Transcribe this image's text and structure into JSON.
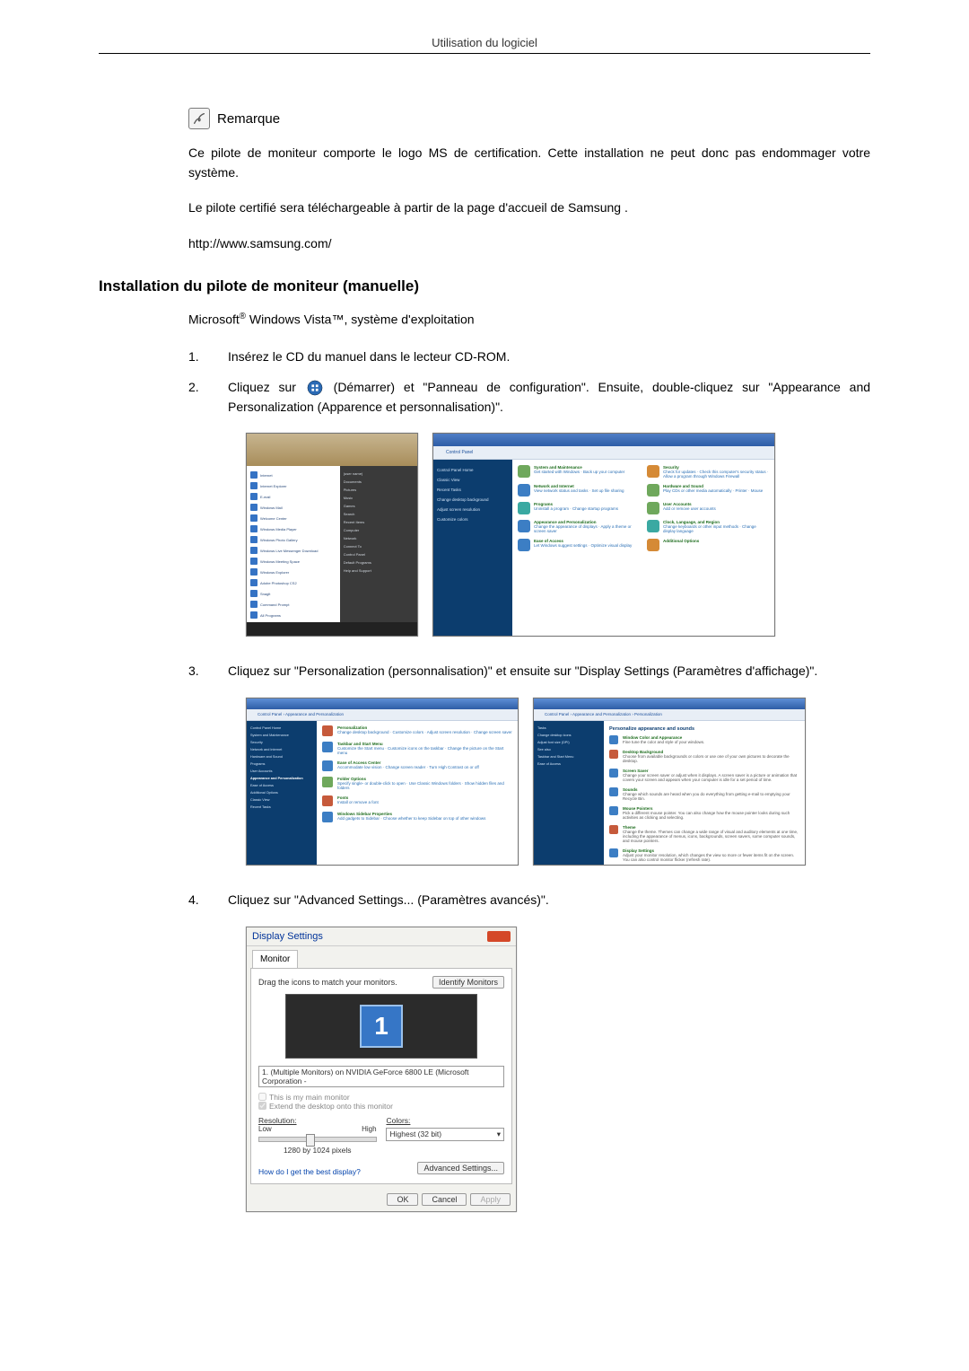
{
  "header": {
    "title": "Utilisation du logiciel"
  },
  "note": {
    "label": "Remarque",
    "p1": "Ce pilote de moniteur comporte le logo MS de certification. Cette installation ne peut donc pas endommager votre système.",
    "p2": "Le pilote certifié sera téléchargeable à partir de la page d'accueil de Samsung .",
    "url": "http://www.samsung.com/"
  },
  "heading": "Installation du pilote de moniteur (manuelle)",
  "os_line_prefix": "Microsoft",
  "os_line_mid": " Windows Vista™",
  "os_line_suffix": ", système d'exploitation",
  "steps": [
    {
      "n": "1.",
      "t": "Insérez le CD du manuel dans le lecteur CD-ROM."
    },
    {
      "n": "2.",
      "t_a": "Cliquez sur",
      "t_b": "(Démarrer) et \"Panneau de configuration\". Ensuite, double-cliquez sur \"Appearance and Personalization (Apparence et personnalisation)\"."
    },
    {
      "n": "3.",
      "t": "Cliquez sur \"Personalization (personnalisation)\" et ensuite sur \"Display Settings (Paramètres d'affichage)\"."
    },
    {
      "n": "4.",
      "t": "Cliquez sur \"Advanced Settings... (Paramètres avancés)\"."
    }
  ],
  "start_menu": {
    "left": [
      "Internet",
      "Internet Explorer",
      "E-mail",
      "Windows Mail",
      "Welcome Center",
      "Windows Media Player",
      "Windows Photo Gallery",
      "Windows Live Messenger Download",
      "Windows Meeting Space",
      "Windows Explorer",
      "Adobe Photoshop CS2",
      "Snaglt",
      "Command Prompt",
      "All Programs"
    ],
    "right": [
      "(user name)",
      "Documents",
      "Pictures",
      "Music",
      "Games",
      "Search",
      "Recent Items",
      "Computer",
      "Network",
      "Connect To",
      "Control Panel",
      "Default Programs",
      "Help and Support"
    ]
  },
  "control_panel": {
    "addr": "Control Panel",
    "side": [
      "Control Panel Home",
      "Classic View",
      "Recent Tasks",
      "Change desktop background",
      "Adjust screen resolution",
      "Customize colors"
    ],
    "cats": [
      {
        "t": "System and Maintenance",
        "s": "Get started with Windows · Back up your computer"
      },
      {
        "t": "Security",
        "s": "Check for updates · Check this computer's security status · Allow a program through Windows Firewall"
      },
      {
        "t": "Network and Internet",
        "s": "View network status and tasks · Set up file sharing"
      },
      {
        "t": "Hardware and Sound",
        "s": "Play CDs or other media automatically · Printer · Mouse"
      },
      {
        "t": "Programs",
        "s": "Uninstall a program · Change startup programs"
      },
      {
        "t": "User Accounts",
        "s": "Add or remove user accounts"
      },
      {
        "t": "Appearance and Personalization",
        "s": "Change the appearance of displays · Apply a theme or screen saver"
      },
      {
        "t": "Clock, Language, and Region",
        "s": "Change keyboards or other input methods · Change display language"
      },
      {
        "t": "Ease of Access",
        "s": "Let Windows suggest settings · Optimize visual display"
      },
      {
        "t": "Additional Options",
        "s": ""
      }
    ]
  },
  "ap_panel": {
    "addr": "Control Panel › Appearance and Personalization",
    "side": [
      "Control Panel Home",
      "System and Maintenance",
      "Security",
      "Network and Internet",
      "Hardware and Sound",
      "Programs",
      "User Accounts",
      "Appearance and Personalization",
      "Ease of Access",
      "Additional Options",
      "Classic View",
      "Recent Tasks"
    ],
    "grps": [
      {
        "h": "Personalization",
        "l": "Change desktop background · Customize colors · Adjust screen resolution · Change screen saver"
      },
      {
        "h": "Taskbar and Start Menu",
        "l": "Customize the Start menu · Customize icons on the taskbar · Change the picture on the Start menu"
      },
      {
        "h": "Ease of Access Center",
        "l": "Accommodate low vision · Change screen reader · Turn High Contrast on or off"
      },
      {
        "h": "Folder Options",
        "l": "Specify single- or double-click to open · Use Classic Windows folders · Show hidden files and folders"
      },
      {
        "h": "Fonts",
        "l": "Install or remove a font"
      },
      {
        "h": "Windows Sidebar Properties",
        "l": "Add gadgets to Sidebar · Choose whether to keep Sidebar on top of other windows"
      }
    ]
  },
  "pers_panel": {
    "addr": "Control Panel › Appearance and Personalization › Personalization",
    "side": [
      "Tasks",
      "Change desktop icons",
      "Adjust font size (DPI)",
      "See also",
      "Taskbar and Start Menu",
      "Ease of Access"
    ],
    "hdr": "Personalize appearance and sounds",
    "rows": [
      {
        "h": "Window Color and Appearance",
        "d": "Fine tune the color and style of your windows."
      },
      {
        "h": "Desktop Background",
        "d": "Choose from available backgrounds or colors or use one of your own pictures to decorate the desktop."
      },
      {
        "h": "Screen Saver",
        "d": "Change your screen saver or adjust when it displays. A screen saver is a picture or animation that covers your screen and appears when your computer is idle for a set period of time."
      },
      {
        "h": "Sounds",
        "d": "Change which sounds are heard when you do everything from getting e-mail to emptying your Recycle Bin."
      },
      {
        "h": "Mouse Pointers",
        "d": "Pick a different mouse pointer. You can also change how the mouse pointer looks during such activities as clicking and selecting."
      },
      {
        "h": "Theme",
        "d": "Change the theme. Themes can change a wide range of visual and auditory elements at one time, including the appearance of menus, icons, backgrounds, screen savers, some computer sounds, and mouse pointers."
      },
      {
        "h": "Display Settings",
        "d": "Adjust your monitor resolution, which changes the view so more or fewer items fit on the screen. You can also control monitor flicker (refresh rate)."
      }
    ]
  },
  "disp": {
    "title": "Display Settings",
    "tab": "Monitor",
    "drag": "Drag the icons to match your monitors.",
    "identify": "Identify Monitors",
    "mon_num": "1",
    "sel": "1. (Multiple Monitors) on NVIDIA GeForce 6800 LE (Microsoft Corporation - ",
    "chk1": "This is my main monitor",
    "chk2": "Extend the desktop onto this monitor",
    "res_label": "Resolution:",
    "res_low": "Low",
    "res_high": "High",
    "res_val": "1280 by 1024 pixels",
    "col_label": "Colors:",
    "col_val": "Highest (32 bit)",
    "link": "How do I get the best display?",
    "adv": "Advanced Settings...",
    "ok": "OK",
    "cancel": "Cancel",
    "apply": "Apply"
  }
}
